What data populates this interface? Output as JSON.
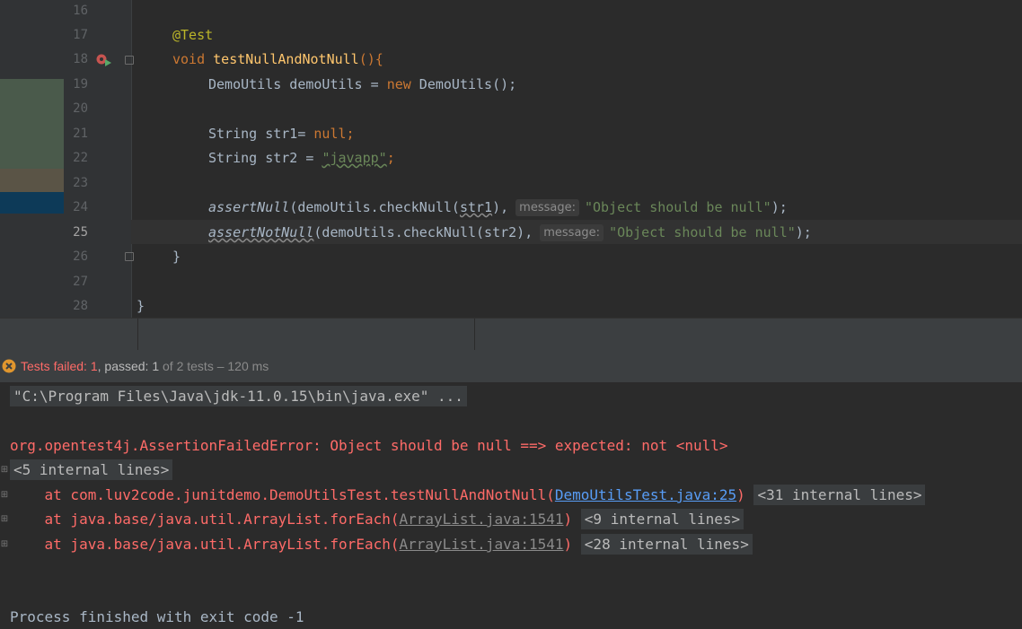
{
  "editor": {
    "line_numbers": [
      "16",
      "17",
      "18",
      "19",
      "20",
      "21",
      "22",
      "23",
      "24",
      "25",
      "26",
      "27",
      "28"
    ],
    "current_line": "25",
    "code": {
      "l17_annotation": "@Test",
      "l18_kw": "void",
      "l18_method": "testNullAndNotNull",
      "l18_tail": "(){",
      "l19_a": "DemoUtils demoUtils = ",
      "l19_kw": "new",
      "l19_b": " DemoUtils();",
      "l21_a": "String str1= ",
      "l21_kw": "null",
      "l21_b": ";",
      "l22_a": "String str2 = ",
      "l22_str": "\"javapp\"",
      "l22_b": ";",
      "l24_call": "assertNull",
      "l24_a": "(demoUtils.checkNull(",
      "l24_arg": "str1",
      "l24_b": "),",
      "l24_hint": "message:",
      "l24_str": "\"Object should be null\"",
      "l24_end": ");",
      "l25_call": "assertNotNull",
      "l25_a": "(demoUtils.checkNull(str2),",
      "l25_hint": "message:",
      "l25_str": "\"Object should be null\"",
      "l25_end": ");",
      "l26": "}",
      "l28": "}"
    }
  },
  "test_status": {
    "failed_label": "Tests failed: ",
    "failed_count": "1",
    "passed_label": ", passed: ",
    "passed_count": "1",
    "rest": " of 2 tests – 120 ms"
  },
  "console": {
    "cmd": "\"C:\\Program Files\\Java\\jdk-11.0.15\\bin\\java.exe\" ...",
    "error": "org.opentest4j.AssertionFailedError: Object should be null ==> expected: not <null>",
    "internal_1": "<5 internal lines>",
    "trace_1_a": "    at com.luv2code.junitdemo.DemoUtilsTest.testNullAndNotNull(",
    "trace_1_link": "DemoUtilsTest.java:25",
    "trace_1_b": ")",
    "internal_2": "<31 internal lines>",
    "trace_2_a": "    at java.base/java.util.ArrayList.forEach(",
    "trace_2_link": "ArrayList.java:1541",
    "trace_2_b": ")",
    "internal_3": "<9 internal lines>",
    "trace_3_a": "    at java.base/java.util.ArrayList.forEach(",
    "trace_3_link": "ArrayList.java:1541",
    "trace_3_b": ")",
    "internal_4": "<28 internal lines>",
    "finish": "Process finished with exit code -1"
  },
  "colors": {
    "background": "#2b2b2b",
    "error": "#ff6b68",
    "keyword": "#cc7832",
    "string": "#6a8759",
    "link": "#589df6"
  }
}
